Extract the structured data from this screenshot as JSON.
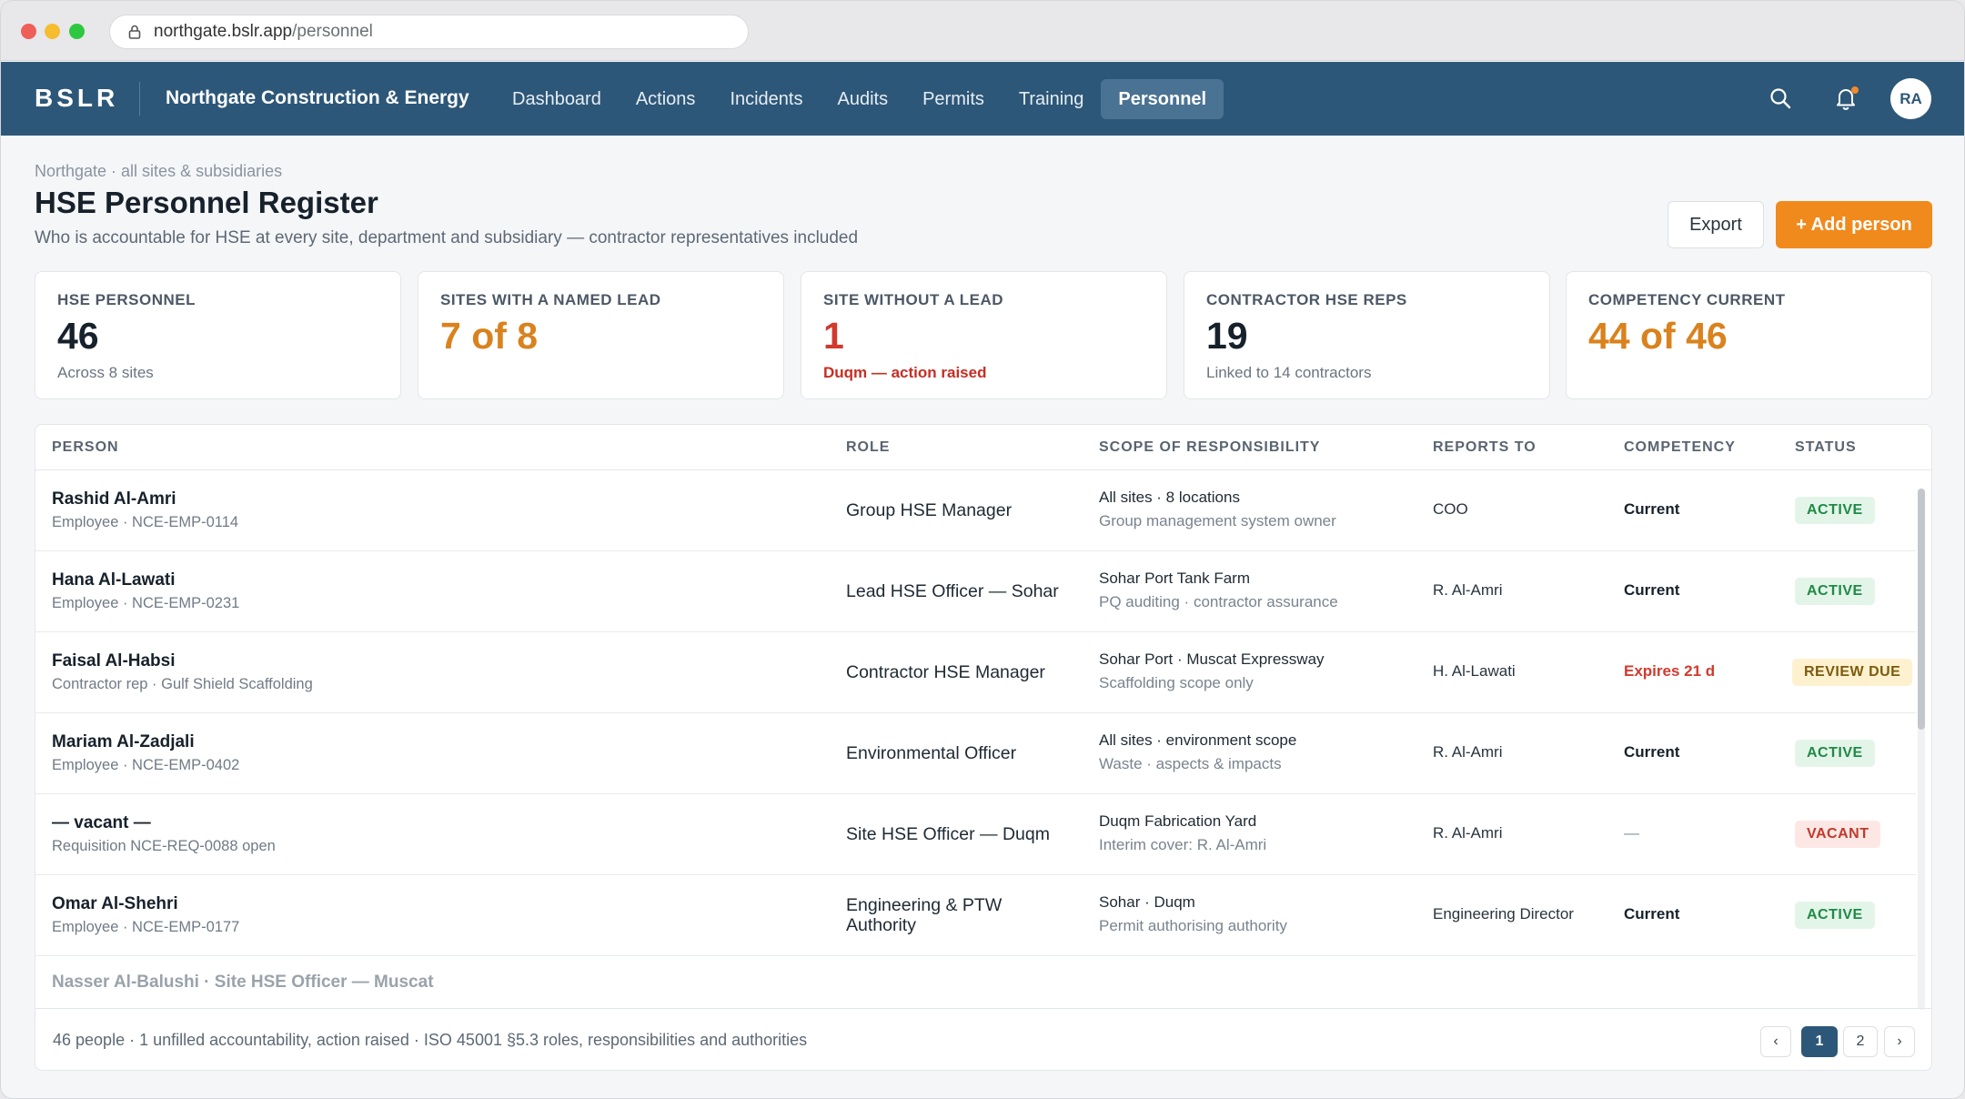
{
  "browser": {
    "url_host": "northgate.bslr.app",
    "url_path": "/personnel"
  },
  "nav": {
    "brand": "BSLR",
    "org": "Northgate Construction & Energy",
    "links": [
      "Dashboard",
      "Actions",
      "Incidents",
      "Audits",
      "Permits",
      "Training",
      "Personnel"
    ],
    "active": "Personnel",
    "avatar_initials": "RA"
  },
  "header": {
    "breadcrumb": "Northgate · all sites & subsidiaries",
    "title": "HSE Personnel Register",
    "subtitle": "Who is accountable for HSE at every site, department and subsidiary — contractor representatives included",
    "export_label": "Export",
    "add_label": "+ Add person"
  },
  "kpis": [
    {
      "label": "HSE PERSONNEL",
      "value": "46",
      "sub": "Across 8 sites"
    },
    {
      "label": "SITES WITH A NAMED LEAD",
      "value": "7 of 8",
      "sub": ""
    },
    {
      "label": "SITE WITHOUT A LEAD",
      "value": "1",
      "sub": "Duqm — action raised"
    },
    {
      "label": "CONTRACTOR HSE REPS",
      "value": "19",
      "sub": "Linked to 14 contractors"
    },
    {
      "label": "COMPETENCY CURRENT",
      "value": "44 of 46",
      "sub": ""
    }
  ],
  "table": {
    "headers": [
      "PERSON",
      "ROLE",
      "SCOPE OF RESPONSIBILITY",
      "REPORTS TO",
      "COMPETENCY",
      "STATUS"
    ],
    "rows": [
      {
        "name": "Rashid Al-Amri",
        "sub": "Employee · NCE-EMP-0114",
        "role": "Group HSE Manager",
        "scope1": "All sites · 8 locations",
        "scope2": "Group management system owner",
        "reports": "COO",
        "competency": "Current",
        "status": "ACTIVE"
      },
      {
        "name": "Hana Al-Lawati",
        "sub": "Employee · NCE-EMP-0231",
        "role": "Lead HSE Officer — Sohar",
        "scope1": "Sohar Port Tank Farm",
        "scope2": "PQ auditing · contractor assurance",
        "reports": "R. Al-Amri",
        "competency": "Current",
        "status": "ACTIVE"
      },
      {
        "name": "Faisal Al-Habsi",
        "sub": "Contractor rep · Gulf Shield Scaffolding",
        "role": "Contractor HSE Manager",
        "scope1": "Sohar Port · Muscat Expressway",
        "scope2": "Scaffolding scope only",
        "reports": "H. Al-Lawati",
        "competency": "Expires 21 d",
        "status": "REVIEW DUE"
      },
      {
        "name": "Mariam Al-Zadjali",
        "sub": "Employee · NCE-EMP-0402",
        "role": "Environmental Officer",
        "scope1": "All sites · environment scope",
        "scope2": "Waste · aspects & impacts",
        "reports": "R. Al-Amri",
        "competency": "Current",
        "status": "ACTIVE"
      },
      {
        "name": "— vacant —",
        "sub": "Requisition NCE-REQ-0088 open",
        "role": "Site HSE Officer — Duqm",
        "scope1": "Duqm Fabrication Yard",
        "scope2": "Interim cover: R. Al-Amri",
        "reports": "R. Al-Amri",
        "competency": "—",
        "status": "VACANT"
      },
      {
        "name": "Omar Al-Shehri",
        "sub": "Employee · NCE-EMP-0177",
        "role_line1": "Engineering & PTW",
        "role_line2": "Authority",
        "scope1": "Sohar · Duqm",
        "scope2": "Permit authorising authority",
        "reports": "Engineering Director",
        "competency": "Current",
        "status": "ACTIVE"
      }
    ],
    "faded_row": "Nasser Al-Balushi · Site HSE Officer — Muscat",
    "footer_text": "46 people · 1 unfilled accountability, action raised · ISO 45001 §5.3 roles, responsibilities and authorities",
    "pagination": {
      "prev": "‹",
      "pages": [
        "1",
        "2"
      ],
      "current": "1",
      "next": "›"
    }
  },
  "colors": {
    "nav_bg": "#2d5778",
    "accent_orange": "#f08a1c",
    "alert_red": "#d13a2e",
    "active_green": "#1f8a46"
  }
}
